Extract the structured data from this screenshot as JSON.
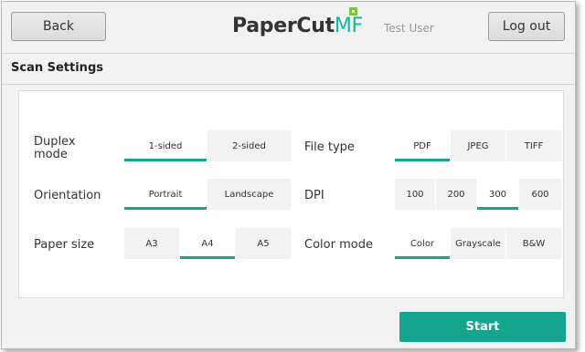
{
  "header": {
    "back_label": "Back",
    "logo_text": "PaperCut",
    "logo_suffix": "MF",
    "user_name": "Test User",
    "logout_label": "Log out"
  },
  "title": "Scan Settings",
  "settings": {
    "duplex": {
      "label": "Duplex mode",
      "options": [
        "1-sided",
        "2-sided"
      ],
      "selected": "1-sided"
    },
    "orientation": {
      "label": "Orientation",
      "options": [
        "Portrait",
        "Landscape"
      ],
      "selected": "Portrait"
    },
    "paper_size": {
      "label": "Paper size",
      "options": [
        "A3",
        "A4",
        "A5"
      ],
      "selected": "A4"
    },
    "file_type": {
      "label": "File type",
      "options": [
        "PDF",
        "JPEG",
        "TIFF"
      ],
      "selected": "PDF"
    },
    "dpi": {
      "label": "DPI",
      "options": [
        "100",
        "200",
        "300",
        "600"
      ],
      "selected": "300"
    },
    "color_mode": {
      "label": "Color mode",
      "options": [
        "Color",
        "Grayscale",
        "B&W"
      ],
      "selected": "Color"
    }
  },
  "start_label": "Start",
  "colors": {
    "accent": "#16a48e",
    "logo_accent": "#1bb3a1",
    "logo_square": "#7ec23b"
  }
}
